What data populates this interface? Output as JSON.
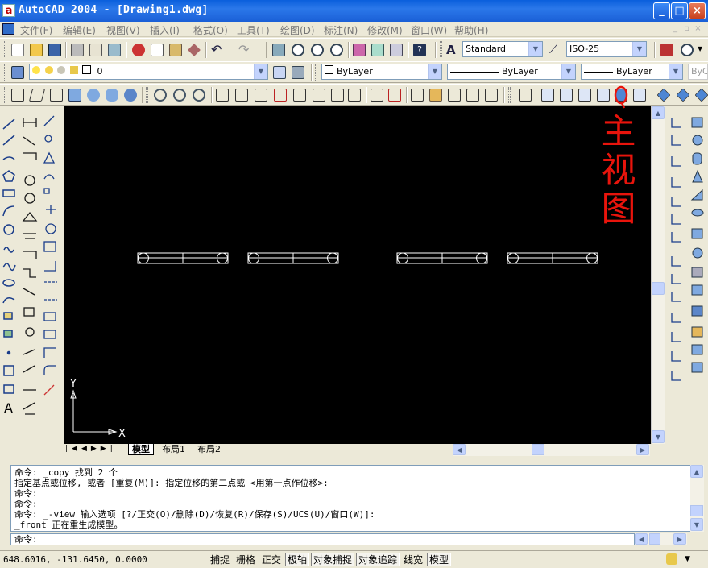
{
  "window": {
    "app_icon": "a",
    "title": "AutoCAD 2004 - [Drawing1.dwg]",
    "minimize": "_",
    "maximize": "□",
    "close": "×"
  },
  "menu": {
    "items": [
      "文件(F)",
      "编辑(E)",
      "视图(V)",
      "插入(I)",
      "格式(O)",
      "工具(T)",
      "绘图(D)",
      "标注(N)",
      "修改(M)",
      "窗口(W)",
      "帮助(H)"
    ]
  },
  "toolbar": {
    "text_style": "Standard",
    "dim_style": "ISO-25",
    "layer": "0",
    "color": "ByLayer",
    "linetype": "ByLayer",
    "lineweight": "ByLayer",
    "plotstyle": "ByCo"
  },
  "annotation": {
    "text": "主视图",
    "color": "#e8140c",
    "icon": "front-view-icon"
  },
  "canvas": {
    "background": "#000000",
    "ucs_y": "Y",
    "ucs_x": "X"
  },
  "layout_tabs": {
    "model": "模型",
    "layout1": "布局1",
    "layout2": "布局2"
  },
  "command": {
    "history": [
      "命令: _copy 找到 2 个",
      "指定基点或位移, 或者 [重复(M)]: 指定位移的第二点或 <用第一点作位移>:",
      "命令:",
      "命令:",
      "命令: _-view 输入选项 [?/正交(O)/删除(D)/恢复(R)/保存(S)/UCS(U)/窗口(W)]:",
      "_front 正在重生成模型。"
    ],
    "prompt": "命令:"
  },
  "status": {
    "coordinates": "648.6016, -131.6450, 0.0000",
    "buttons": [
      {
        "label": "捕捉",
        "on": false
      },
      {
        "label": "栅格",
        "on": false
      },
      {
        "label": "正交",
        "on": false
      },
      {
        "label": "极轴",
        "on": true
      },
      {
        "label": "对象捕捉",
        "on": true
      },
      {
        "label": "对象追踪",
        "on": true
      },
      {
        "label": "线宽",
        "on": false
      },
      {
        "label": "模型",
        "on": true
      }
    ]
  }
}
